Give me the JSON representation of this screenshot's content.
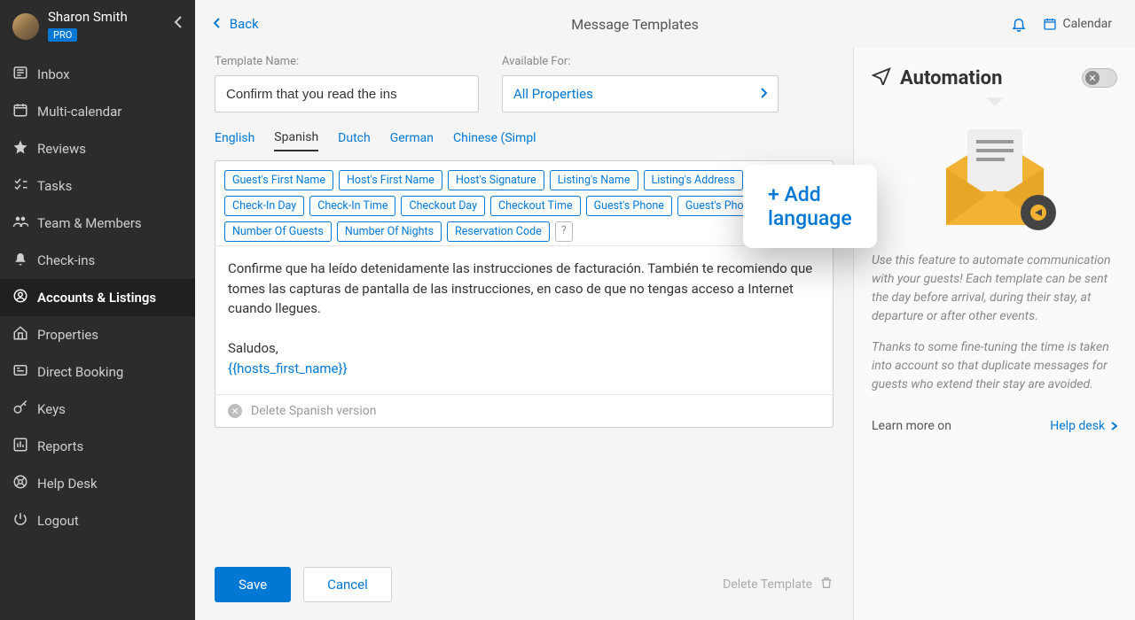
{
  "user": {
    "name": "Sharon Smith",
    "badge": "PRO"
  },
  "sidebar": {
    "items": [
      {
        "icon": "inbox",
        "label": "Inbox"
      },
      {
        "icon": "calendar",
        "label": "Multi-calendar"
      },
      {
        "icon": "star",
        "label": "Reviews"
      },
      {
        "icon": "tasks",
        "label": "Tasks"
      },
      {
        "icon": "team",
        "label": "Team & Members"
      },
      {
        "icon": "bell",
        "label": "Check-ins"
      },
      {
        "icon": "accounts",
        "label": "Accounts & Listings",
        "active": true
      },
      {
        "icon": "home",
        "label": "Properties"
      },
      {
        "icon": "booking",
        "label": "Direct Booking"
      },
      {
        "icon": "key",
        "label": "Keys"
      },
      {
        "icon": "reports",
        "label": "Reports"
      }
    ],
    "bottom": [
      {
        "icon": "help",
        "label": "Help Desk"
      },
      {
        "icon": "power",
        "label": "Logout"
      }
    ]
  },
  "topbar": {
    "back": "Back",
    "title": "Message Templates",
    "calendar": "Calendar"
  },
  "form": {
    "name_label": "Template Name:",
    "name_value": "Confirm that you read the ins",
    "available_label": "Available For:",
    "available_value": "All Properties"
  },
  "languages": {
    "tabs": [
      "English",
      "Spanish",
      "Dutch",
      "German",
      "Chinese (Simpl"
    ],
    "active": "Spanish",
    "add_label": "+ Add language"
  },
  "tokens": [
    "Guest's First Name",
    "Host's First Name",
    "Host's Signature",
    "Listing's Name",
    "Listing's Address",
    "Check-In Day",
    "Check-In Time",
    "Checkout Day",
    "Checkout Time",
    "Guest's Phone",
    "Guest's Phone:4",
    "Number Of Guests",
    "Number Of Nights",
    "Reservation Code"
  ],
  "message": {
    "body": "Confirme que ha leído detenidamente las instrucciones de facturación. También te recomiendo que tomes las capturas de pantalla de las instrucciones, en caso de que no tengas acceso a Internet cuando llegues.",
    "signoff": "Saludos,",
    "variable": "{{hosts_first_name}}"
  },
  "delete_lang": "Delete Spanish version",
  "footer": {
    "save": "Save",
    "cancel": "Cancel",
    "delete": "Delete Template"
  },
  "automation": {
    "title": "Automation",
    "p1": "Use this feature to automate communication with your guests! Each template can be sent the day before arrival, during their stay, at departure or after other events.",
    "p2": "Thanks to some fine-tuning the time is taken into account so that duplicate messages for guests who extend their stay are avoided.",
    "learn": "Learn more on",
    "helpdesk": "Help desk"
  }
}
